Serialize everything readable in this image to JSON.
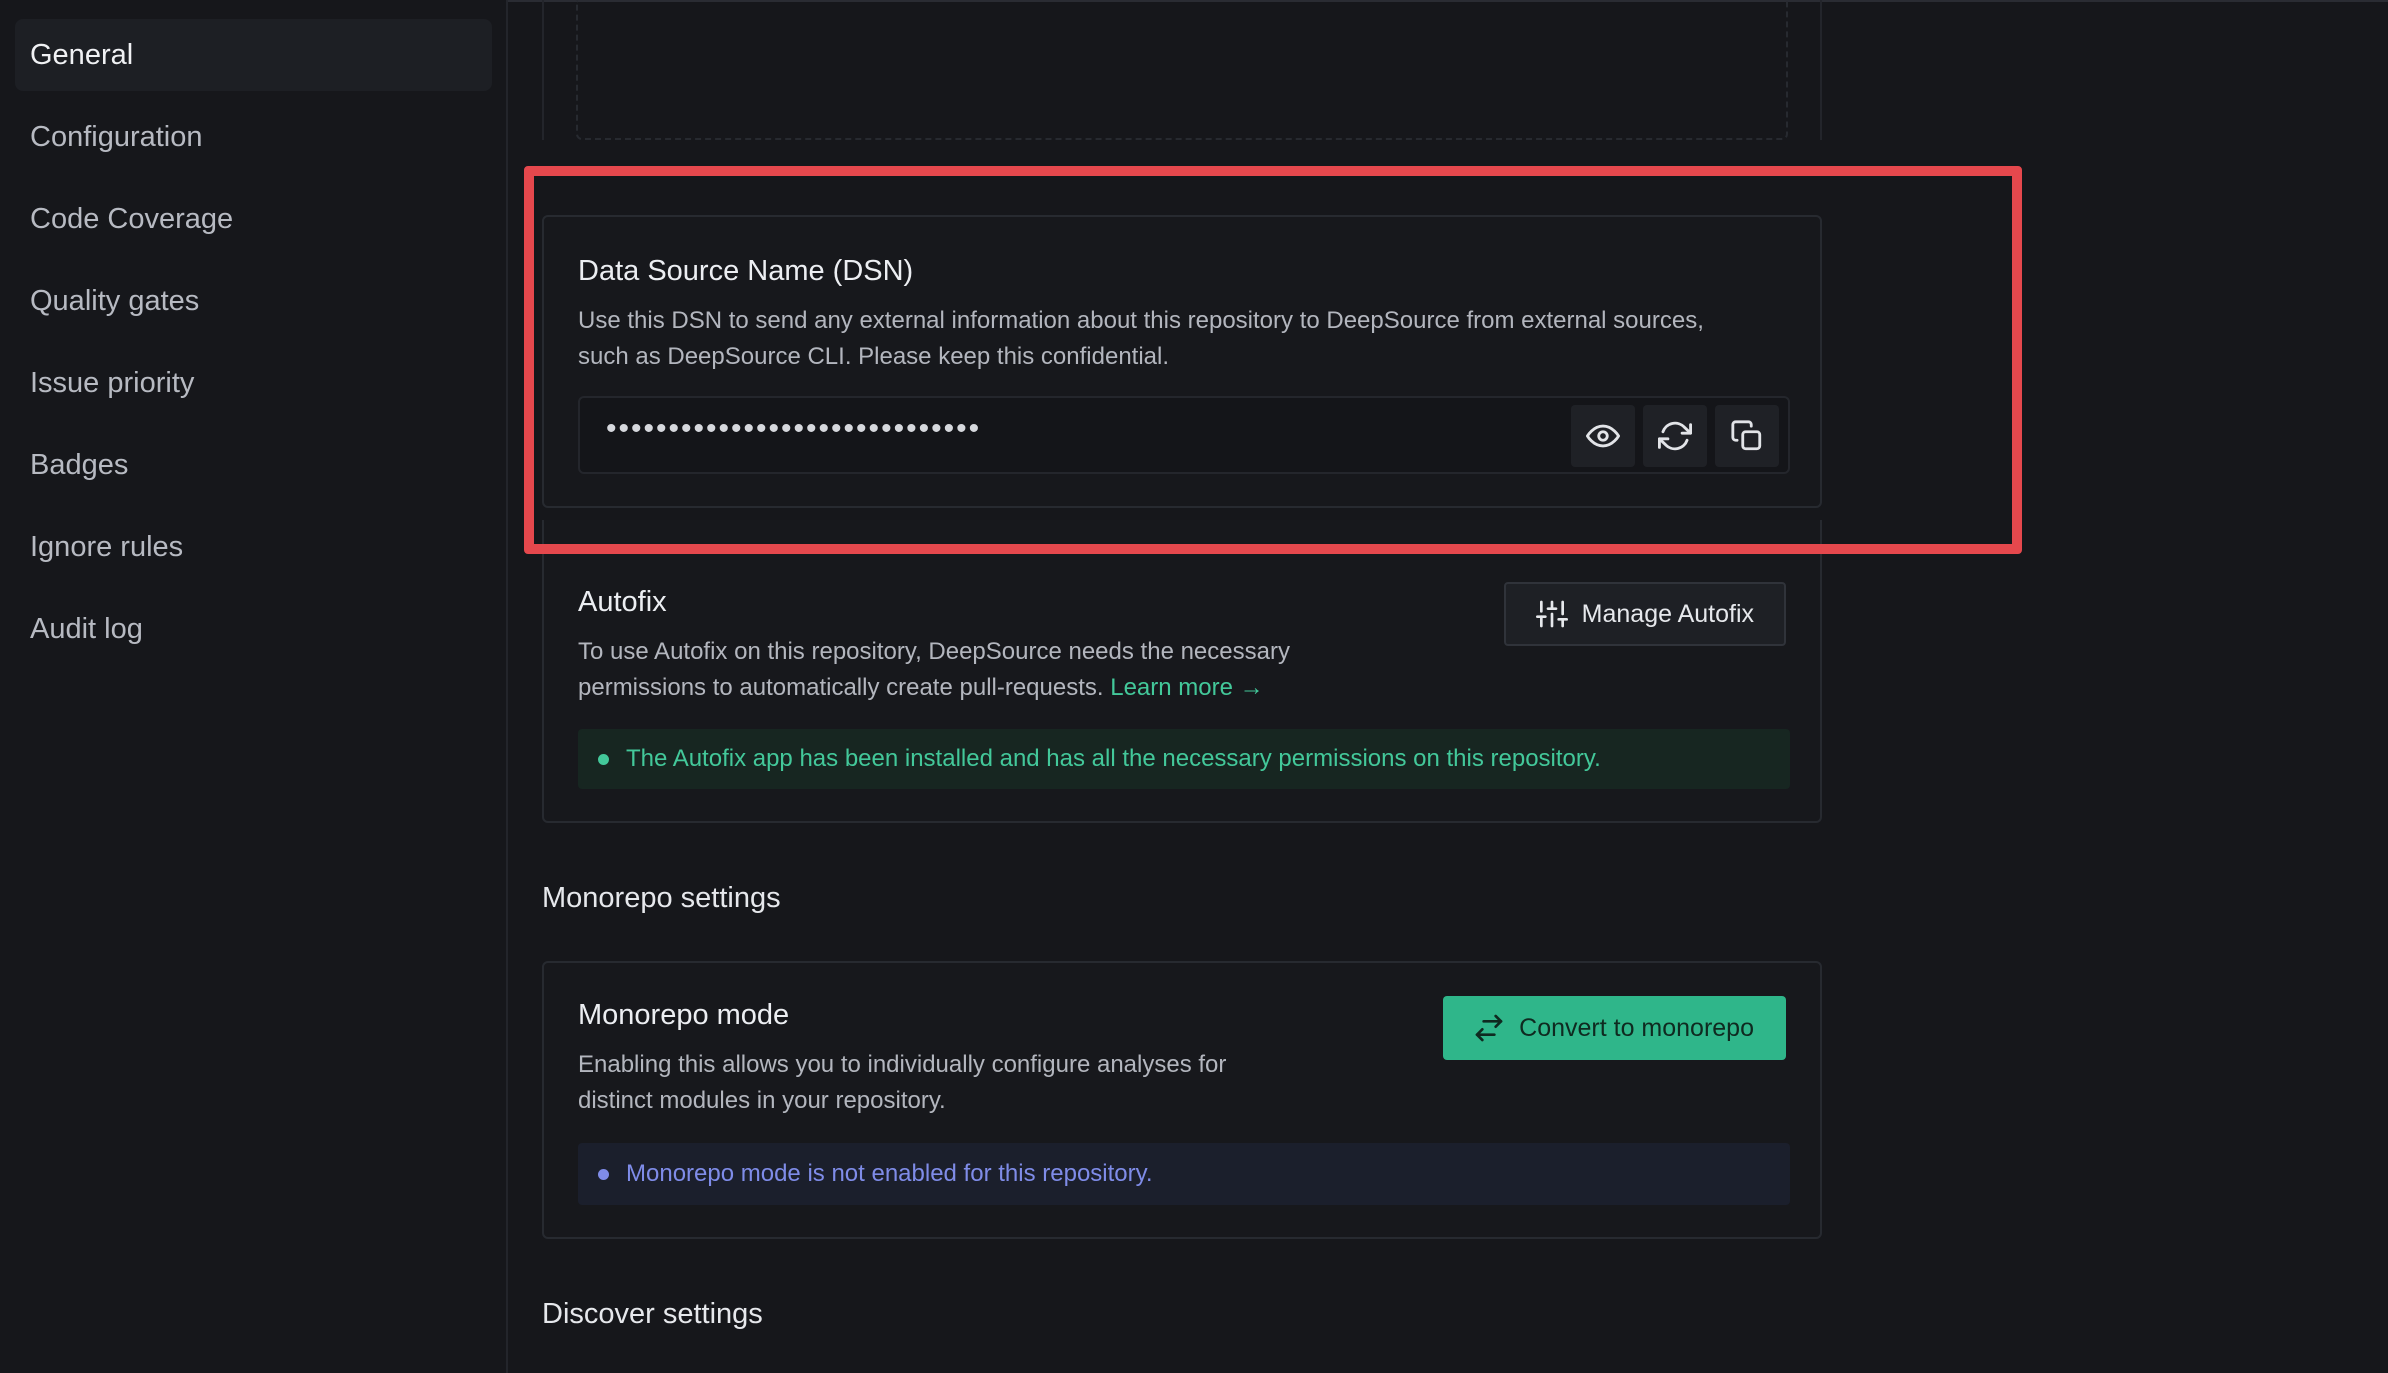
{
  "sidebar": {
    "items": [
      {
        "label": "General",
        "active": true
      },
      {
        "label": "Configuration"
      },
      {
        "label": "Code Coverage"
      },
      {
        "label": "Quality gates"
      },
      {
        "label": "Issue priority"
      },
      {
        "label": "Badges"
      },
      {
        "label": "Ignore rules"
      },
      {
        "label": "Audit log"
      }
    ]
  },
  "dsn": {
    "title": "Data Source Name (DSN)",
    "description_line1": "Use this DSN to send any external information about this repository to DeepSource from external sources,",
    "description_line2": "such as DeepSource CLI. Please keep this confidential.",
    "masked_value": "••••••••••••••••••••••••••••••",
    "icons": [
      "eye-icon",
      "refresh-icon",
      "copy-icon"
    ]
  },
  "autofix": {
    "title": "Autofix",
    "description_line1": "To use Autofix on this repository, DeepSource needs the necessary",
    "description_line2": "permissions to automatically create pull-requests.",
    "learn_more": "Learn more →",
    "button_label": "Manage Autofix",
    "status": "The Autofix app has been installed and has all the necessary permissions on this repository."
  },
  "monorepo_section": {
    "heading": "Monorepo settings",
    "title": "Monorepo mode",
    "description_line1": "Enabling this allows you to individually configure analyses for",
    "description_line2": "distinct modules in your repository.",
    "button_label": "Convert to monorepo",
    "status": "Monorepo mode is not enabled for this repository."
  },
  "discover_section": {
    "heading": "Discover settings"
  },
  "colors": {
    "accent_green": "#2fb68a",
    "highlight_red": "#e5484d",
    "info_blue": "#7f8ce8"
  }
}
